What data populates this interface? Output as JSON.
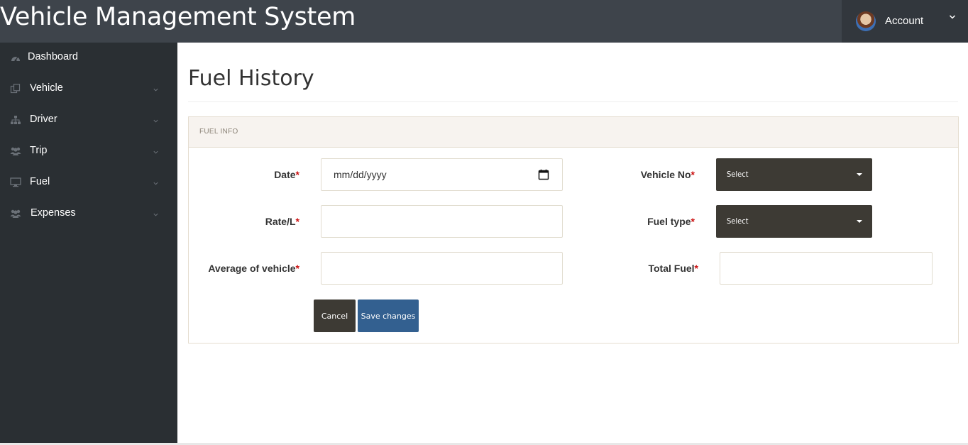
{
  "app": {
    "title": "Vehicle Management System"
  },
  "account": {
    "label": "Account",
    "icon": "chevron-down-icon"
  },
  "sidebar": {
    "items": [
      {
        "label": "Dashboard",
        "icon": "dashboard-icon",
        "has_submenu": false
      },
      {
        "label": "Vehicle",
        "icon": "copy-icon",
        "has_submenu": true
      },
      {
        "label": "Driver",
        "icon": "sitemap-icon",
        "has_submenu": true
      },
      {
        "label": "Trip",
        "icon": "users-icon",
        "has_submenu": true
      },
      {
        "label": "Fuel",
        "icon": "monitor-icon",
        "has_submenu": true
      },
      {
        "label": "Expenses",
        "icon": "users-icon",
        "has_submenu": true
      }
    ]
  },
  "page": {
    "title": "Fuel History"
  },
  "panel": {
    "heading": "FUEL INFO"
  },
  "form": {
    "date": {
      "label": "Date",
      "required": "*",
      "placeholder": "mm/dd/yyyy"
    },
    "rate": {
      "label": "Rate/L",
      "required": "*",
      "value": ""
    },
    "average": {
      "label": "Average of vehicle",
      "required": "*",
      "value": ""
    },
    "vehicle_no": {
      "label": "Vehicle No",
      "required": "*",
      "selected": "Select"
    },
    "fuel_type": {
      "label": "Fuel type",
      "required": "*",
      "selected": "Select"
    },
    "total_fuel": {
      "label": "Total Fuel",
      "required": "*",
      "value": ""
    },
    "cancel_label": "Cancel",
    "save_label": "Save changes"
  },
  "colors": {
    "topbar": "#3e444b",
    "sidebar": "#2a2f33",
    "select_bg": "#3d3a34",
    "save_button": "#336090",
    "required": "#cc1111"
  }
}
